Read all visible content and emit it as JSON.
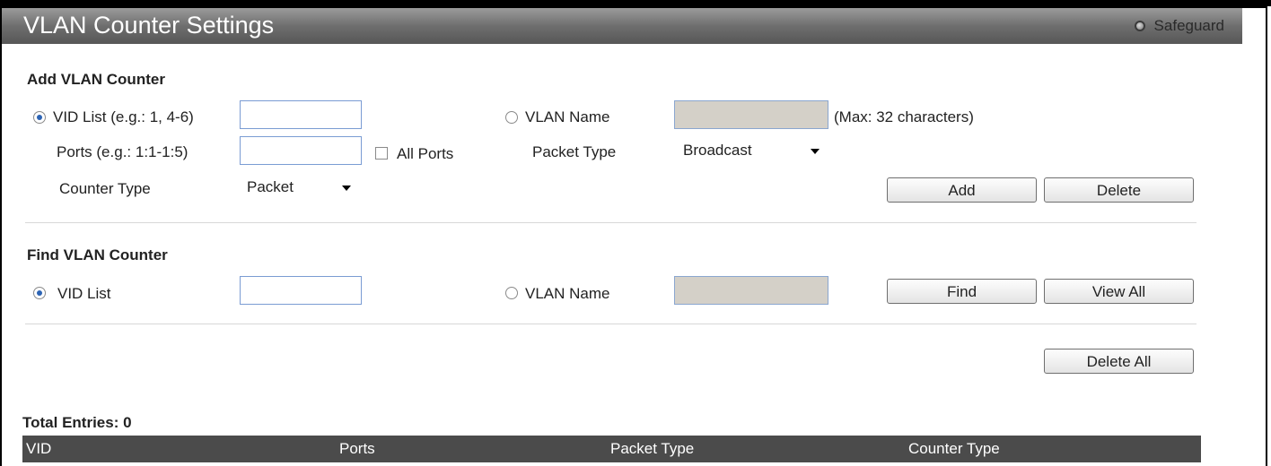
{
  "title": "VLAN Counter Settings",
  "safeguard_label": "Safeguard",
  "add_section": {
    "title": "Add VLAN Counter",
    "vid_list_label": "VID List (e.g.: 1, 4-6)",
    "vid_list_value": "",
    "vid_list_selected": true,
    "vlan_name_label": "VLAN Name",
    "vlan_name_value": "",
    "vlan_name_hint": "(Max: 32 characters)",
    "ports_label": "Ports (e.g.: 1:1-1:5)",
    "ports_value": "",
    "all_ports_label": "All Ports",
    "all_ports_checked": false,
    "packet_type_label": "Packet Type",
    "packet_type_value": "Broadcast",
    "counter_type_label": "Counter Type",
    "counter_type_value": "Packet",
    "add_button": "Add",
    "delete_button": "Delete"
  },
  "find_section": {
    "title": "Find VLAN Counter",
    "vid_list_label": "VID List",
    "vid_list_value": "",
    "vid_list_selected": true,
    "vlan_name_label": "VLAN Name",
    "vlan_name_value": "",
    "find_button": "Find",
    "view_all_button": "View All"
  },
  "delete_all_button": "Delete All",
  "total_entries": "Total Entries: 0",
  "table": {
    "columns": [
      "VID",
      "Ports",
      "Packet Type",
      "Counter Type"
    ],
    "rows": []
  },
  "colors": {
    "title_bar": "#6e6e6e",
    "table_header": "#4b4b4b",
    "radio_selected": "#2d64b4"
  }
}
